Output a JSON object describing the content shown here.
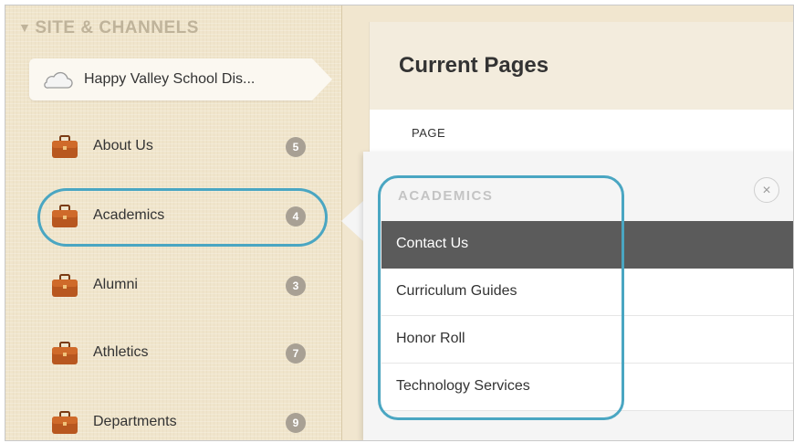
{
  "sidebar": {
    "header": "SITE & CHANNELS",
    "site_label": "Happy Valley School Dis...",
    "channels": [
      {
        "label": "About Us",
        "count": "5"
      },
      {
        "label": "Academics",
        "count": "4"
      },
      {
        "label": "Alumni",
        "count": "3"
      },
      {
        "label": "Athletics",
        "count": "7"
      },
      {
        "label": "Departments",
        "count": "9"
      }
    ]
  },
  "main": {
    "title": "Current Pages",
    "column_header": "PAGE"
  },
  "popover": {
    "title": "ACADEMICS",
    "close_glyph": "×",
    "items": [
      {
        "label": "Contact Us"
      },
      {
        "label": "Curriculum Guides"
      },
      {
        "label": "Honor Roll"
      },
      {
        "label": "Technology Services"
      }
    ]
  },
  "colors": {
    "highlight": "#4aa6c2",
    "badge": "#a8a094",
    "active_item": "#5b5b5b",
    "sidebar_bg": "#f0e5cc"
  }
}
